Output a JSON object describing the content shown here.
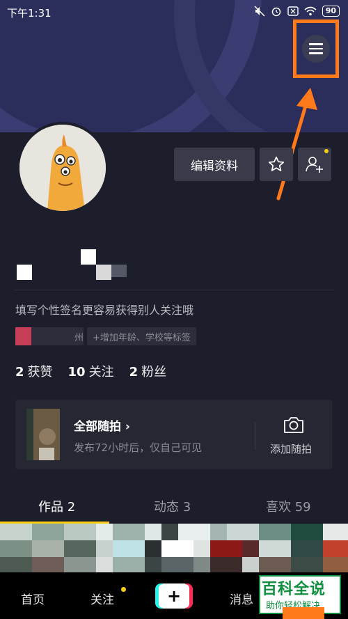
{
  "status_bar": {
    "time": "下午1:31",
    "battery": "90",
    "icons": [
      "mute-icon",
      "alarm-icon",
      "sim-icon",
      "wifi-icon"
    ]
  },
  "profile": {
    "edit_button": "编辑资料",
    "bio": "填写个性签名更容易获得别人关注哦",
    "tag_location": "州",
    "tag_add": "+增加年龄、学校等标签"
  },
  "stats": [
    {
      "count": "2",
      "label": "获赞"
    },
    {
      "count": "10",
      "label": "关注"
    },
    {
      "count": "2",
      "label": "粉丝"
    }
  ],
  "random_shots": {
    "title": "全部随拍",
    "chevron": "›",
    "subtitle": "发布72小时后，仅自己可见",
    "camera_label": "添加随拍"
  },
  "tabs": [
    {
      "label": "作品 2",
      "active": true
    },
    {
      "label": "动态 3",
      "active": false
    },
    {
      "label": "喜欢 59",
      "active": false
    }
  ],
  "nav": {
    "home": "首页",
    "follow": "关注",
    "add": "+",
    "messages": "消息"
  },
  "watermark": {
    "top": "百科全说",
    "bottom": "助你轻松解决"
  },
  "colors": {
    "accent": "#face15",
    "highlight": "#ff7a1a",
    "background": "#161823"
  }
}
